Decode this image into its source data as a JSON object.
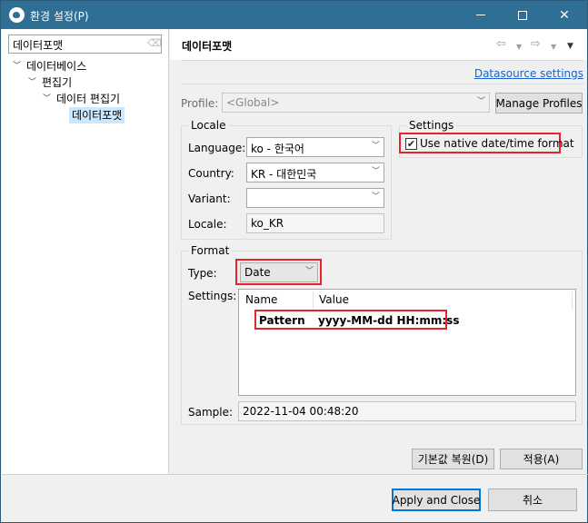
{
  "window": {
    "title": "환경 설정(P)"
  },
  "filter": {
    "value": "데이터포맷"
  },
  "tree": [
    {
      "label": "데이터베이스"
    },
    {
      "label": "편집기"
    },
    {
      "label": "데이터 편집기"
    },
    {
      "label": "데이터포맷"
    }
  ],
  "page": {
    "title": "데이터포맷",
    "datasource_link": "Datasource settings"
  },
  "profile": {
    "label": "Profile:",
    "value": "<Global>",
    "manage_button": "Manage Profiles"
  },
  "locale": {
    "title": "Locale",
    "language_label": "Language:",
    "language_value": "ko - 한국어",
    "country_label": "Country:",
    "country_value": "KR - 대한민국",
    "variant_label": "Variant:",
    "variant_value": "",
    "locale_label": "Locale:",
    "locale_value": "ko_KR"
  },
  "settings": {
    "title": "Settings",
    "native_label": "Use native date/time format",
    "native_checked": true
  },
  "format": {
    "title": "Format",
    "type_label": "Type:",
    "type_value": "Date",
    "settings_label": "Settings:",
    "columns": [
      "Name",
      "Value"
    ],
    "rows": [
      {
        "name": "Pattern",
        "value": "yyyy-MM-dd HH:mm:ss"
      }
    ],
    "sample_label": "Sample:",
    "sample_value": "2022-11-04 00:48:20"
  },
  "buttons": {
    "restore_defaults": "기본값 복원(D)",
    "apply": "적용(A)",
    "apply_close": "Apply and Close",
    "cancel": "취소"
  },
  "colors": {
    "titlebar": "#2f6e95",
    "highlight": "#e8222c",
    "link": "#1a64c8",
    "selection": "#cce8ff"
  }
}
